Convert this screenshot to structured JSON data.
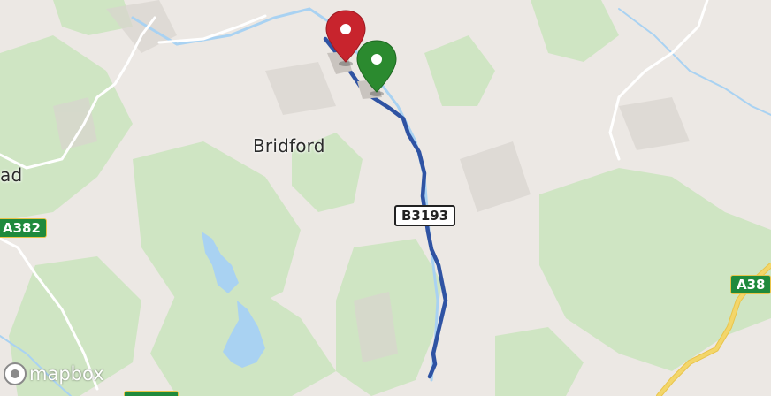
{
  "map": {
    "provider": "mapbox",
    "colors": {
      "background": "#ece8e4",
      "forest": "#cfe5c3",
      "water": "#a9d2f2",
      "route": "#2f53a3",
      "major_road": "#f3d66a",
      "start_marker": "#2b8a2f",
      "end_marker": "#c8242d"
    },
    "labels": {
      "place": "Bridford",
      "place_partial_left": "ad"
    },
    "road_shields": {
      "b_road": "B3193",
      "a_road_left": "A382",
      "a_road_right": "A38"
    },
    "markers": {
      "start": {
        "color": "green",
        "icon": "map-pin-icon"
      },
      "end": {
        "color": "red",
        "icon": "map-pin-icon"
      }
    },
    "attribution": {
      "logo_text": "mapbox",
      "logo_icon": "mapbox-logo-icon"
    }
  }
}
